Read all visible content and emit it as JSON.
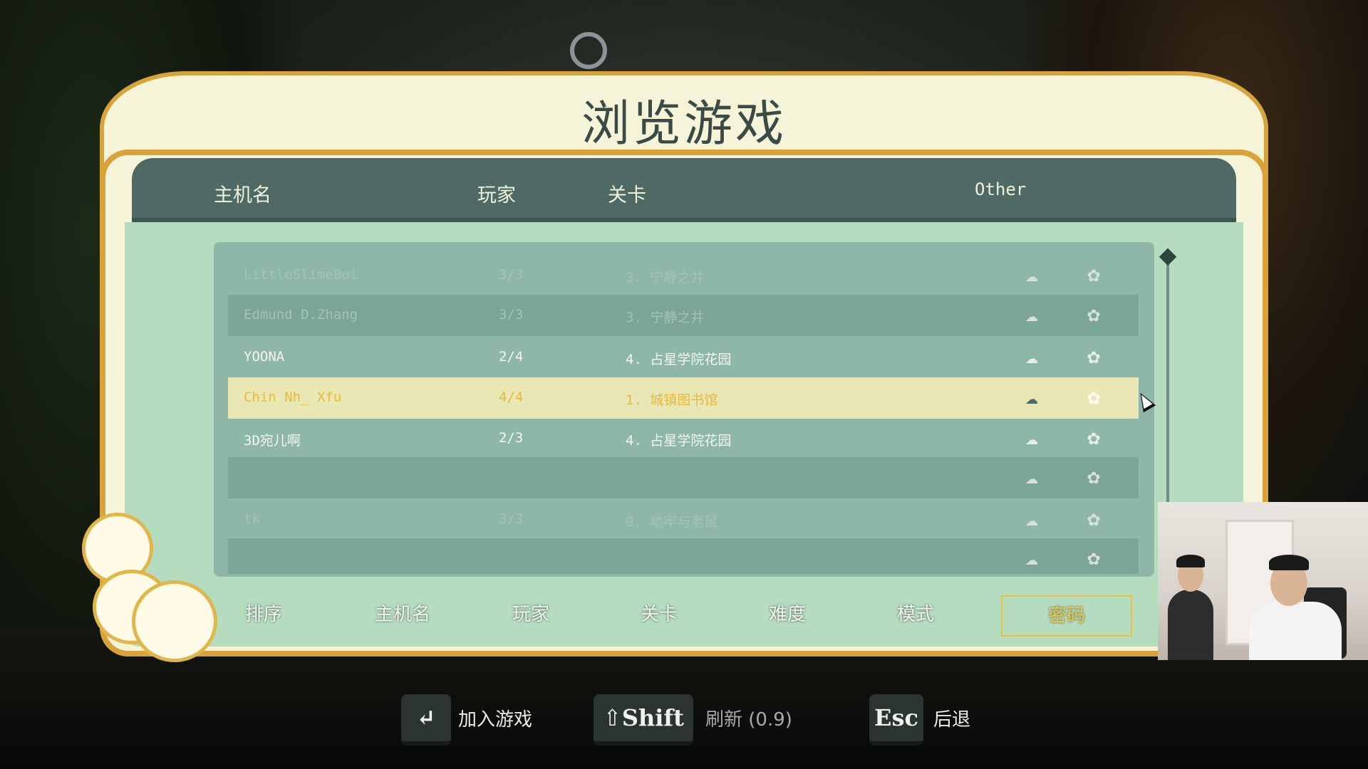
{
  "title": "浏览游戏",
  "header": {
    "host": "主机名",
    "players": "玩家",
    "level": "关卡",
    "other": "Other"
  },
  "rows": [
    {
      "host": "LittleSlimeBoi",
      "players": "3/3",
      "level": "3. 宁静之井",
      "state": "faded"
    },
    {
      "host": "Edmund D.Zhang",
      "players": "3/3",
      "level": "3. 宁静之井",
      "state": "faded"
    },
    {
      "host": "YOONA",
      "players": "2/4",
      "level": "4. 占星学院花园",
      "state": "normal"
    },
    {
      "host": "Chin Nh_ Xfu",
      "players": "4/4",
      "level": "1. 城镇图书馆",
      "state": "selected"
    },
    {
      "host": "3D宛儿啊",
      "players": "2/3",
      "level": "4. 占星学院花园",
      "state": "normal"
    },
    {
      "host": "",
      "players": "",
      "level": "",
      "state": "faded"
    },
    {
      "host": "tk",
      "players": "3/3",
      "level": "9. 地牢与老鼠",
      "state": "faded"
    },
    {
      "host": "",
      "players": "",
      "level": "",
      "state": "faded"
    }
  ],
  "sort_bar": {
    "label": "排序",
    "options": [
      "主机名",
      "玩家",
      "关卡",
      "难度",
      "模式",
      "密码"
    ],
    "active": "密码"
  },
  "key_hints": [
    {
      "key": "↵",
      "label": "加入游戏",
      "dim": false
    },
    {
      "key": "⇧Shift",
      "label": "刷新 (0.9)",
      "dim": true
    },
    {
      "key": "Esc",
      "label": "后退",
      "dim": false
    }
  ],
  "icons": {
    "row_icon1": "cloud-icon",
    "row_icon2": "flower-icon",
    "scroll": "scroll-knob-icon"
  },
  "colors": {
    "frame_gold": "#d8a43a",
    "panel_cream": "#f5f3d8",
    "header_teal": "#4f6a65",
    "selected_text": "#e8b93a"
  }
}
